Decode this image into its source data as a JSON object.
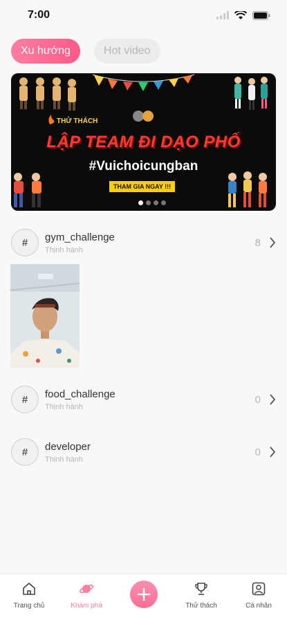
{
  "status": {
    "time": "7:00"
  },
  "tabs": [
    {
      "label": "Xu hướng",
      "active": true
    },
    {
      "label": "Hot video",
      "active": false
    }
  ],
  "banner": {
    "kicker": "THỬ THÁCH",
    "title": "LẬP TEAM ĐI DẠO PHỐ",
    "hashtag": "#Vuichoicungban",
    "cta": "THAM GIA NGAY !!!",
    "dots": 4,
    "active_dot": 0
  },
  "challenges": [
    {
      "title": "gym_challenge",
      "subtitle": "Thịnh hành",
      "count": "8"
    },
    {
      "title": "food_challenge",
      "subtitle": "Thịnh hành",
      "count": "0"
    },
    {
      "title": "developer",
      "subtitle": "Thịnh hành",
      "count": "0"
    }
  ],
  "bottom_nav": [
    {
      "label": "Trang chủ",
      "icon": "home-icon",
      "active": false
    },
    {
      "label": "Khám phá",
      "icon": "planet-icon",
      "active": true
    },
    {
      "label": "",
      "icon": "plus-icon",
      "active": false
    },
    {
      "label": "Thử thách",
      "icon": "trophy-icon",
      "active": false
    },
    {
      "label": "Cá nhân",
      "icon": "profile-icon",
      "active": false
    }
  ],
  "colors": {
    "accent": "#ff7ea0",
    "muted": "#b5b5b5"
  }
}
